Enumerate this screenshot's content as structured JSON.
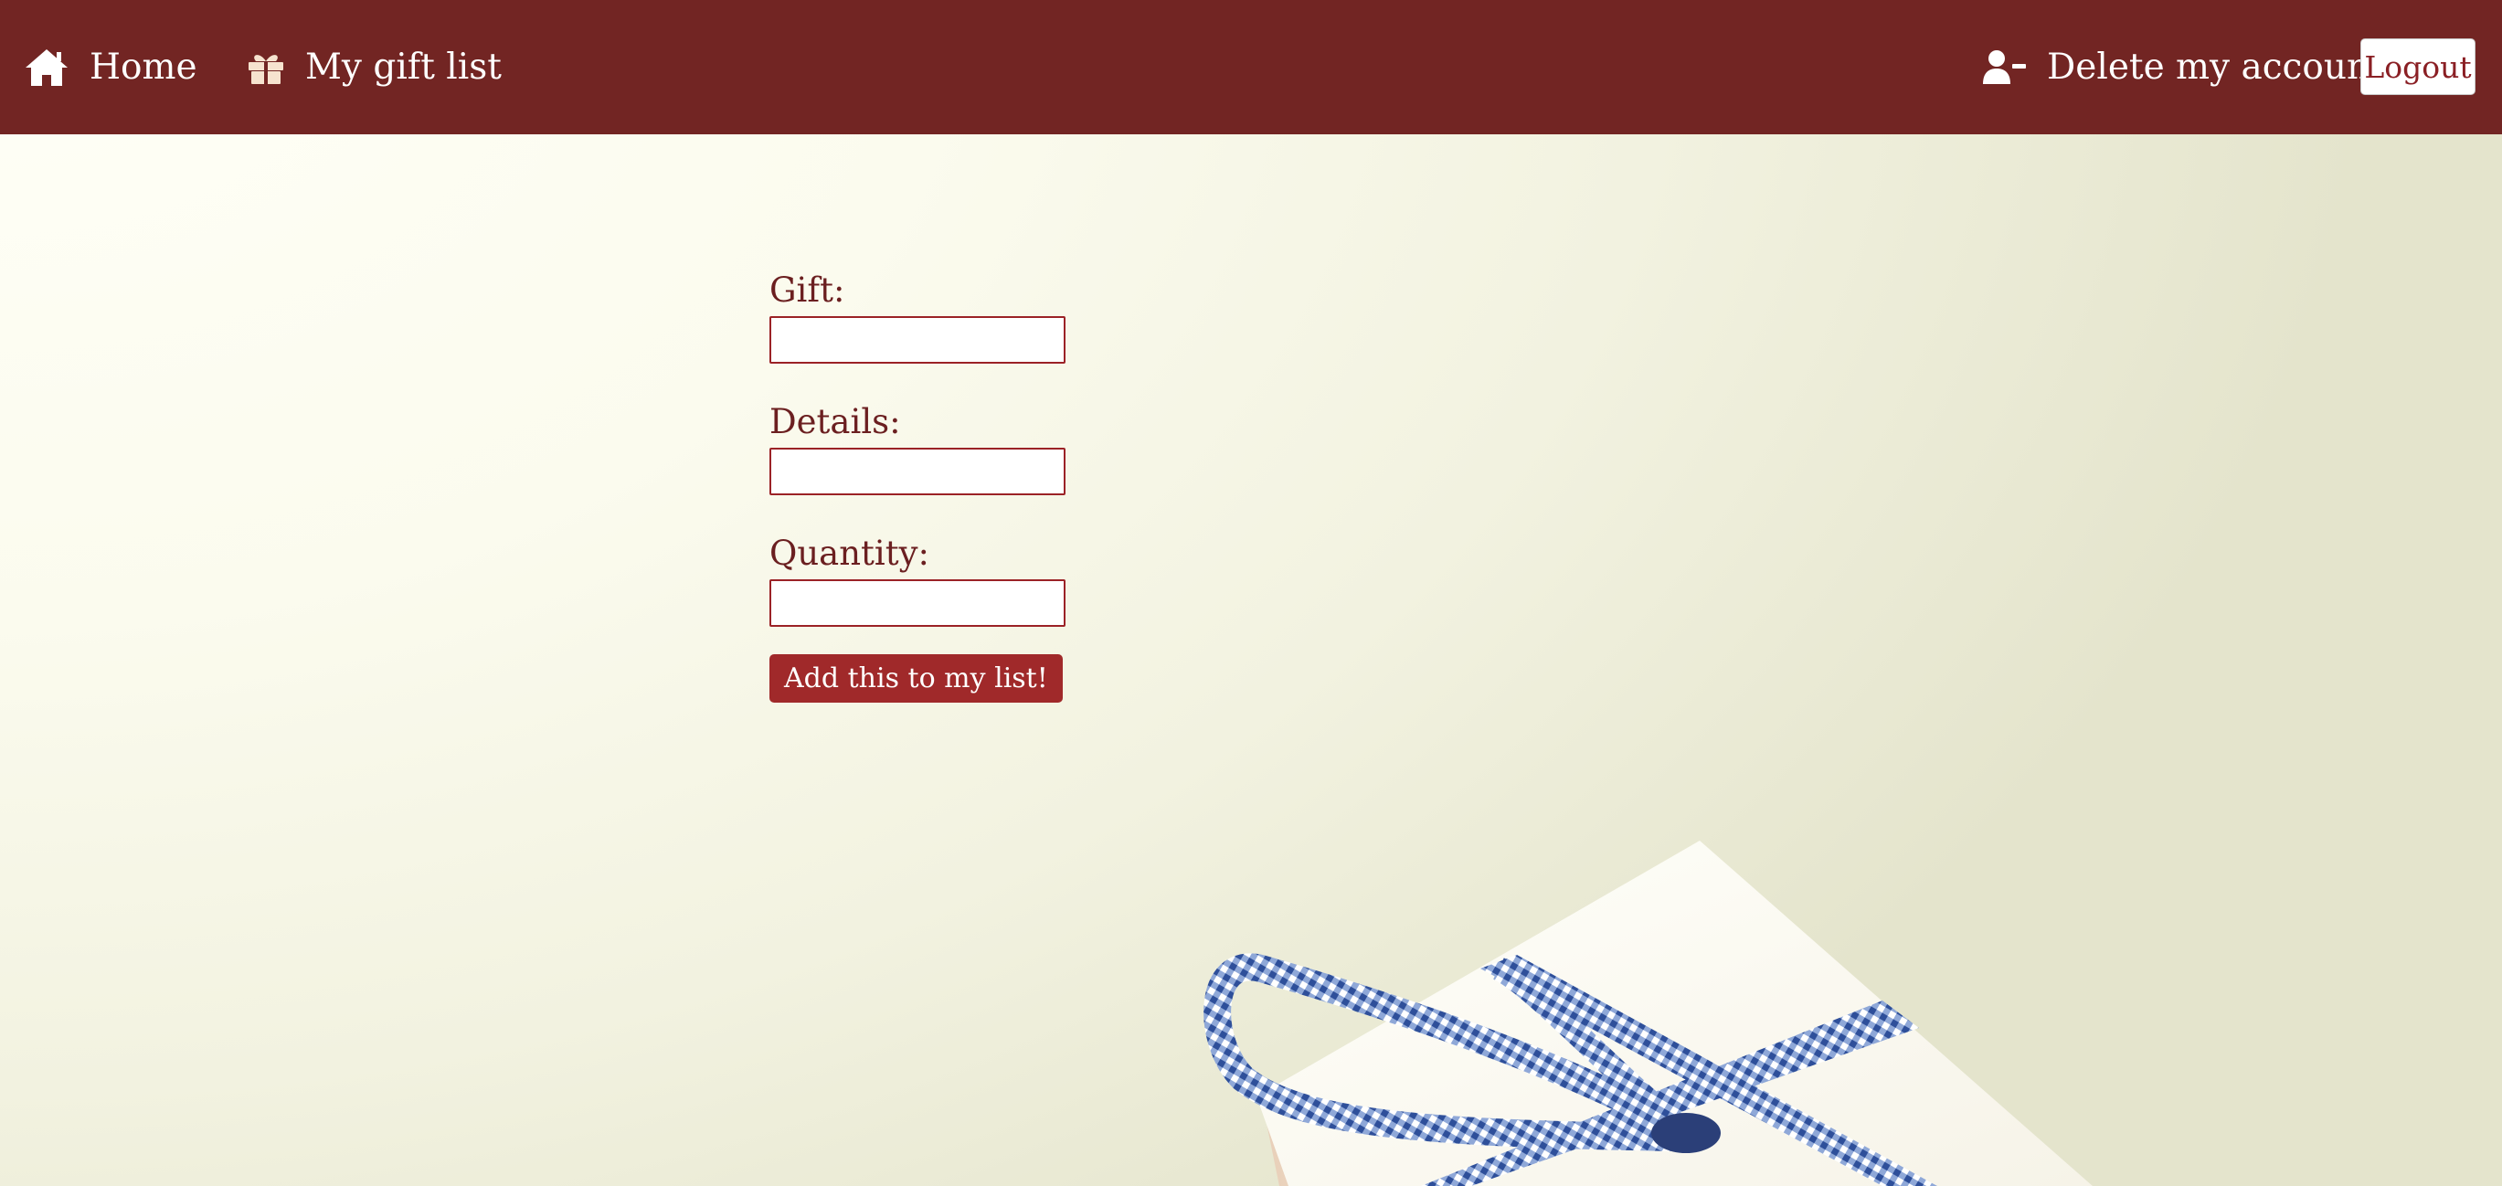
{
  "nav": {
    "home_label": "Home",
    "home_icon": "home-icon",
    "giftlist_label": "My gift list",
    "giftlist_icon": "gift-icon",
    "delete_label": "Delete my account",
    "delete_icon": "user-minus-icon",
    "logout_label": "Logout"
  },
  "form": {
    "gift_label": "Gift:",
    "gift_value": "",
    "details_label": "Details:",
    "details_value": "",
    "quantity_label": "Quantity:",
    "quantity_value": "",
    "submit_label": "Add this to my list!"
  },
  "colors": {
    "navbar": "#722523",
    "accent": "#a0292a",
    "label_text": "#6b1f20",
    "background": "#fbfbee",
    "ribbon": "#3a5fa8"
  }
}
